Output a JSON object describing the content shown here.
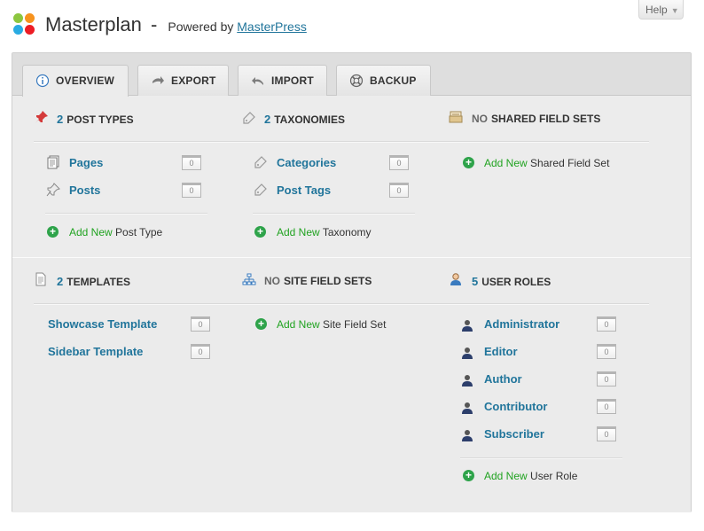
{
  "header": {
    "title": "Masterplan",
    "dash": "-",
    "powered_prefix": "Powered by",
    "powered_link": "MasterPress",
    "help_label": "Help",
    "help_arrow": "▼",
    "logo_colors": [
      "#8cc63f",
      "#f7931e",
      "#29abe2",
      "#ed1c24"
    ]
  },
  "tabs": [
    {
      "label": "OVERVIEW",
      "icon": "info-icon",
      "active": true
    },
    {
      "label": "EXPORT",
      "icon": "export-arrow-icon",
      "active": false
    },
    {
      "label": "IMPORT",
      "icon": "import-arrow-icon",
      "active": false
    },
    {
      "label": "BACKUP",
      "icon": "lifebuoy-icon",
      "active": false
    }
  ],
  "post_types": {
    "count": "2",
    "heading": "POST TYPES",
    "items": [
      {
        "label": "Pages",
        "count": "0"
      },
      {
        "label": "Posts",
        "count": "0"
      }
    ],
    "add_new": "Add New",
    "add_what": "Post Type"
  },
  "taxonomies": {
    "count": "2",
    "heading": "TAXONOMIES",
    "items": [
      {
        "label": "Categories",
        "count": "0"
      },
      {
        "label": "Post Tags",
        "count": "0"
      }
    ],
    "add_new": "Add New",
    "add_what": "Taxonomy"
  },
  "shared_field_sets": {
    "count": "NO",
    "heading": "SHARED FIELD SETS",
    "add_new": "Add New",
    "add_what": "Shared Field Set"
  },
  "templates": {
    "count": "2",
    "heading": "TEMPLATES",
    "items": [
      {
        "label": "Showcase Template",
        "count": "0"
      },
      {
        "label": "Sidebar Template",
        "count": "0"
      }
    ]
  },
  "site_field_sets": {
    "count": "NO",
    "heading": "SITE FIELD SETS",
    "add_new": "Add New",
    "add_what": "Site Field Set"
  },
  "user_roles": {
    "count": "5",
    "heading": "USER ROLES",
    "items": [
      {
        "label": "Administrator",
        "count": "0"
      },
      {
        "label": "Editor",
        "count": "0"
      },
      {
        "label": "Author",
        "count": "0"
      },
      {
        "label": "Contributor",
        "count": "0"
      },
      {
        "label": "Subscriber",
        "count": "0"
      }
    ],
    "add_new": "Add New",
    "add_what": "User Role"
  },
  "colors": {
    "link": "#21759b",
    "add_new": "#21a321",
    "plus": "#2ea34a"
  }
}
